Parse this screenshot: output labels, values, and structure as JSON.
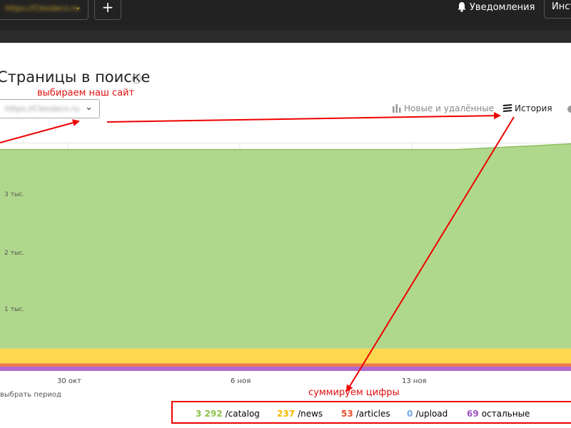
{
  "topbar": {
    "site_name": "https://Cleodecs.ru",
    "add_label": "+",
    "notifications_label": "Уведомления",
    "tools_label": "Инст"
  },
  "page": {
    "title": "Страницы в поиске",
    "info_glyph": "i",
    "site_url": "https://Cleodecs.ru",
    "tabs": {
      "new_removed": "Новые и удалённые",
      "history": "История"
    }
  },
  "annotations": {
    "choose_site": "выбираем наш сайт",
    "sum_numbers": "суммируем цифры"
  },
  "chart_data": {
    "type": "area",
    "x_ticks": [
      "30 окт",
      "6 ноя",
      "13 ноя"
    ],
    "y_ticks": [
      "3 тыс.",
      "2 тыс.",
      "1 тыс."
    ],
    "ylim": [
      0,
      3670
    ],
    "stacked": true,
    "series": [
      {
        "name": "/catalog",
        "color": "#b0d88c",
        "start": 3200,
        "end": 3292
      },
      {
        "name": "/news",
        "color": "#ffd84d",
        "start": 237,
        "end": 237
      },
      {
        "name": "/articles",
        "color": "#f07a50",
        "start": 53,
        "end": 53
      },
      {
        "name": "/upload",
        "color": "#6fa8e8",
        "start": 0,
        "end": 0
      },
      {
        "name": "остальные",
        "color": "#b06ad0",
        "start": 69,
        "end": 69
      }
    ]
  },
  "period_label": "выбрать период",
  "summary": [
    {
      "value": "3 292",
      "label": "/catalog",
      "color": "#8ac24a"
    },
    {
      "value": "237",
      "label": "/news",
      "color": "#f5b800"
    },
    {
      "value": "53",
      "label": "/articles",
      "color": "#e84d2a"
    },
    {
      "value": "0",
      "label": "/upload",
      "color": "#6fa8e8"
    },
    {
      "value": "69",
      "label": "остальные",
      "color": "#a050c0"
    }
  ]
}
